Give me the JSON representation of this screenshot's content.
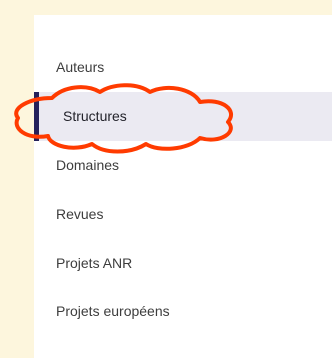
{
  "nav": {
    "items": [
      {
        "label": "Auteurs",
        "active": false
      },
      {
        "label": "Structures",
        "active": true
      },
      {
        "label": "Domaines",
        "active": false
      },
      {
        "label": "Revues",
        "active": false
      },
      {
        "label": "Projets ANR",
        "active": false
      },
      {
        "label": "Projets européens",
        "active": false
      }
    ]
  },
  "colors": {
    "page_background": "#fdf6dd",
    "panel_background": "#ffffff",
    "active_background": "#ebeaf2",
    "active_indicator": "#25215a",
    "annotation_stroke": "#ff3b00",
    "text": "#3d3d3d"
  }
}
